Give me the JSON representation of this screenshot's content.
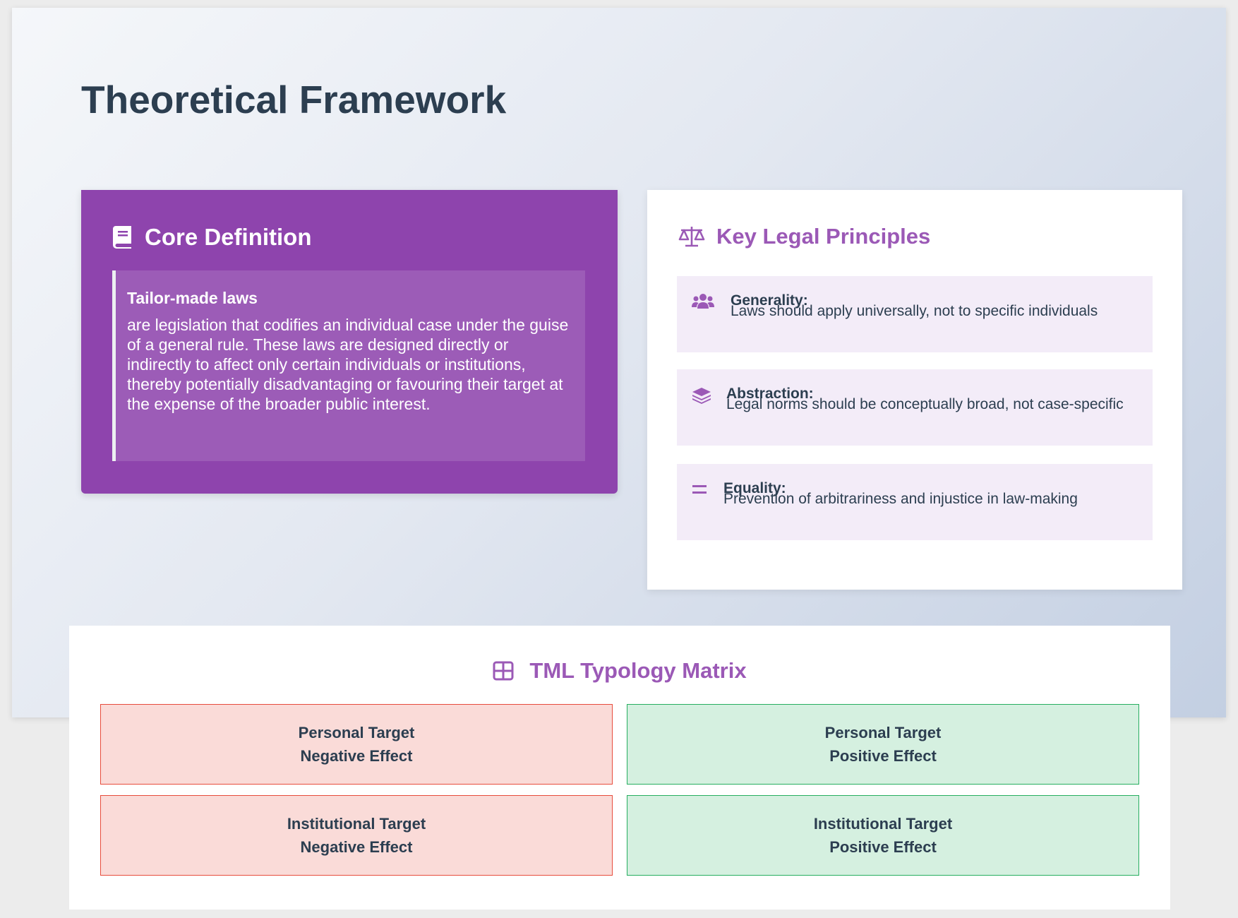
{
  "page": {
    "title": "Theoretical Framework"
  },
  "core": {
    "heading": "Core Definition",
    "icon": "book-icon",
    "term": "Tailor-made laws",
    "text": "are legislation that codifies an individual case under the guise of a general rule. These laws are designed directly or indirectly to affect only certain individuals or institutions, thereby potentially disadvantaging or favouring their target at the expense of the broader public interest."
  },
  "principles": {
    "heading": "Key Legal Principles",
    "icon": "balance-scale-icon",
    "items": [
      {
        "name": "Generality:",
        "desc": "Laws should apply universally, not to specific individuals",
        "icon": "users-icon"
      },
      {
        "name": "Abstraction:",
        "desc": "Legal norms should be conceptually broad, not case-specific",
        "icon": "layer-group-icon"
      },
      {
        "name": "Equality:",
        "desc": "Prevention of arbitrariness and injustice in law-making",
        "icon": "equals-icon"
      }
    ]
  },
  "matrix": {
    "heading": "TML Typology Matrix",
    "icon": "table-grid-icon",
    "cells": [
      {
        "target": "Personal Target",
        "effect": "Negative Effect",
        "tone": "negative"
      },
      {
        "target": "Personal Target",
        "effect": "Positive Effect",
        "tone": "positive"
      },
      {
        "target": "Institutional Target",
        "effect": "Negative Effect",
        "tone": "negative"
      },
      {
        "target": "Institutional Target",
        "effect": "Positive Effect",
        "tone": "positive"
      }
    ]
  },
  "colors": {
    "accent": "#9b59b6",
    "core_bg": "#8e44ad",
    "text": "#2c3e50",
    "negative_bg": "#fadbd8",
    "negative_border": "#e74c3c",
    "positive_bg": "#d5f0e0",
    "positive_border": "#27ae60"
  }
}
